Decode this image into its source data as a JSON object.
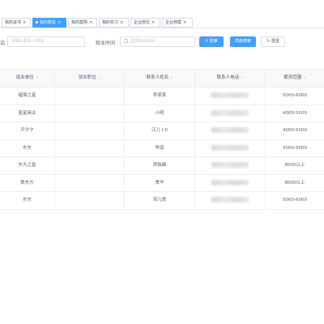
{
  "tags": [
    {
      "label": "我的证书",
      "active": false
    },
    {
      "label": "我的概览",
      "active": true
    },
    {
      "label": "我的案例",
      "active": false
    },
    {
      "label": "我的实习",
      "active": false
    },
    {
      "label": "企业岗位",
      "active": false
    },
    {
      "label": "企业档案",
      "active": false
    }
  ],
  "filters": {
    "contact_label": "话",
    "contact_placeholder": "请输入联系人电话",
    "time_label": "就业时间",
    "time_placeholder": "选择就业时间",
    "search_label": "搜索",
    "advanced_label": "高级搜索",
    "reset_label": "重置"
  },
  "table": {
    "headers": [
      "就业单位",
      "就业职位",
      "联系人姓名",
      "联系人电话",
      "薪资范围"
    ],
    "rows": [
      {
        "company": "璀璨之星",
        "position": "",
        "contact": "李某某",
        "salary": "5000-6000"
      },
      {
        "company": "星星商业",
        "position": "",
        "contact": "小明",
        "salary": "4000-5000"
      },
      {
        "company": "开夕夕",
        "position": "",
        "contact": "江儿卜0",
        "salary": "4000-5000"
      },
      {
        "company": "东东",
        "position": "",
        "contact": "李南",
        "salary": "4000-5000"
      },
      {
        "company": "东大之星",
        "position": "",
        "contact": "肃独蜂",
        "salary": "8000以上"
      },
      {
        "company": "数东方",
        "position": "",
        "contact": "季华",
        "salary": "8000以上"
      },
      {
        "company": "东东",
        "position": "",
        "contact": "宋几哥",
        "salary": "5000-6000"
      }
    ]
  }
}
